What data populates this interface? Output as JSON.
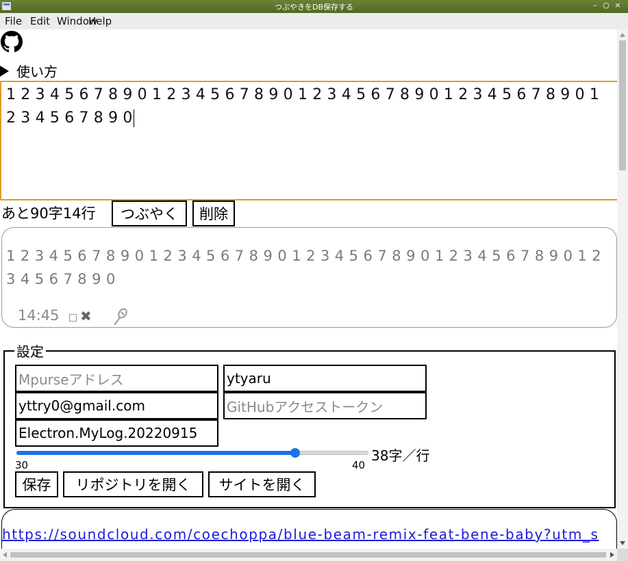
{
  "window": {
    "title": "つぶやきをDB保存する",
    "controls": [
      "–",
      "○",
      "×"
    ]
  },
  "menu": {
    "items": [
      "File",
      "Edit",
      "Window",
      "Help"
    ]
  },
  "header": {
    "github_icon": "github-icon",
    "howto_label": "使い方"
  },
  "editor": {
    "value": "12345678901234567890123456789012345678901234567890"
  },
  "compose": {
    "remaining": "あと90字14行",
    "tweet_button": "つぶやく",
    "delete_button": "削除"
  },
  "post": {
    "text": "12345678901234567890123456789012345678901234567890",
    "time": "14:45",
    "delete_icon": "✖"
  },
  "settings": {
    "legend": "設定",
    "mpurse_placeholder": "Mpurseアドレス",
    "mpurse_value": "",
    "username": "ytyaru",
    "email": "yttry0@gmail.com",
    "token_placeholder": "GitHubアクセストークン",
    "token_value": "",
    "repo_name": "Electron.MyLog.20220915",
    "slider": {
      "min": "30",
      "max": "40",
      "value": 38,
      "label": "38字／行"
    },
    "save_button": "保存",
    "open_repo_button": "リポジトリを開く",
    "open_site_button": "サイトを開く"
  },
  "music": {
    "link": "https://soundcloud.com/coechoppa/blue-beam-remix-feat-bene-baby?utm_s"
  },
  "colors": {
    "titlebar": "#5a7429",
    "focus_border": "#e09a2a",
    "slider_accent": "#1a73e8",
    "link": "#1a1ad8"
  }
}
